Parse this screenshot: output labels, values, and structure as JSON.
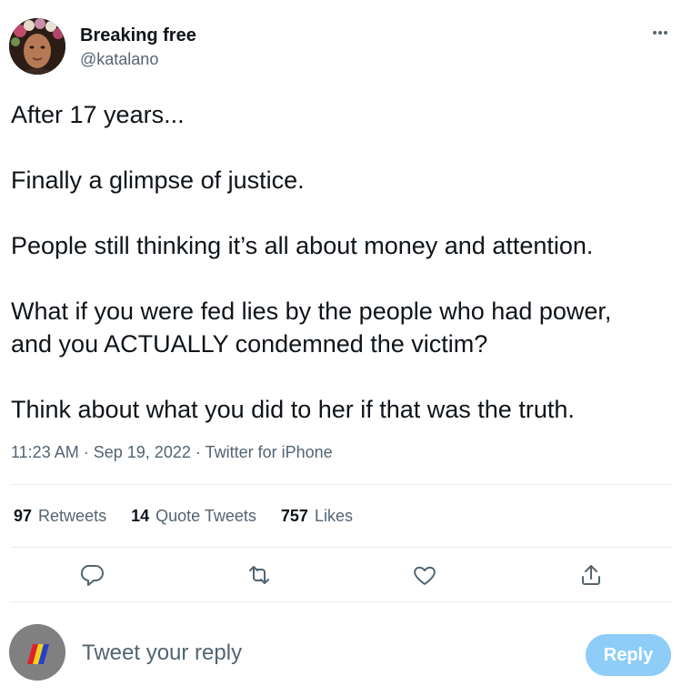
{
  "author": {
    "display_name": "Breaking free",
    "handle": "@katalano",
    "avatar_icon": "profile-photo"
  },
  "more_icon": "more-horizontal-icon",
  "tweet": {
    "paragraphs": [
      "After 17 years...",
      "Finally a glimpse of justice.",
      "People still thinking it’s all about money and attention.",
      "What if you were fed lies by the people who had power,",
      "and you ACTUALLY condemned the victim?",
      "Think about what you did to her if that was the truth."
    ]
  },
  "meta": {
    "time": "11:23 AM",
    "separator": "·",
    "date": "Sep 19, 2022",
    "source": "Twitter for iPhone"
  },
  "stats": {
    "retweets_count": "97",
    "retweets_label": "Retweets",
    "quotes_count": "14",
    "quotes_label": "Quote Tweets",
    "likes_count": "757",
    "likes_label": "Likes"
  },
  "actions": {
    "reply_icon": "reply-icon",
    "retweet_icon": "retweet-icon",
    "like_icon": "heart-icon",
    "share_icon": "share-icon"
  },
  "composer": {
    "placeholder": "Tweet your reply",
    "button_label": "Reply",
    "button_color": "#8ecdf8"
  },
  "colors": {
    "text": "#0f1419",
    "secondary": "#536471",
    "divider": "#e6ecf0",
    "icon": "#536471"
  }
}
